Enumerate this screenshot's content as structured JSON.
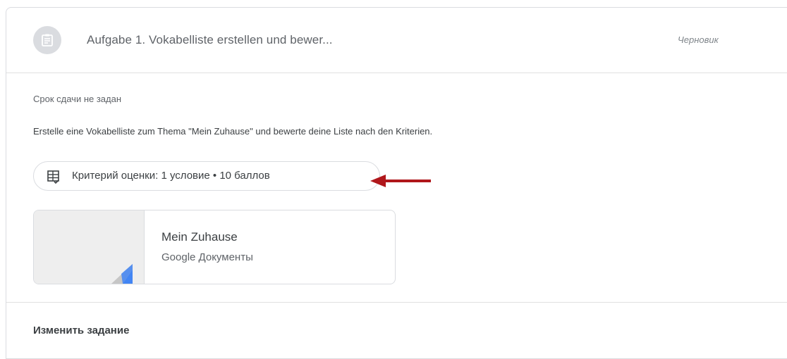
{
  "assignment": {
    "title": "Aufgabe 1. Vokabelliste erstellen und bewer...",
    "status": "Черновик",
    "icon": "assignment-icon",
    "due": "Срок сдачи не задан",
    "description": "Erstelle eine Vokabelliste zum Thema \"Mein Zuhause\" und bewerte deine Liste nach den Kriterien."
  },
  "rubric": {
    "icon": "rubric-icon",
    "label": "Критерий оценки: 1 условие • 10 баллов"
  },
  "annotation": {
    "icon": "arrow-left-icon",
    "color": "#b0171b"
  },
  "attachment": {
    "name": "Mein Zuhause",
    "type": "Google Документы",
    "icon": "google-docs-corner-icon",
    "accent": "#4285f4"
  },
  "footer": {
    "edit_label": "Изменить задание"
  }
}
